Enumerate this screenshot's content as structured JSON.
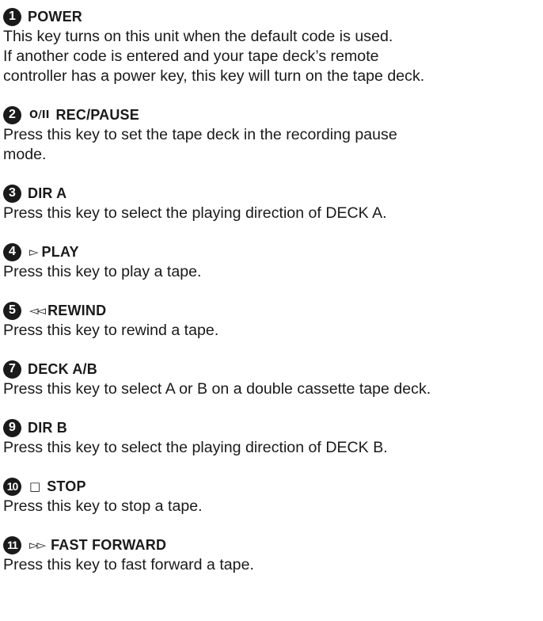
{
  "entries": [
    {
      "number": "1",
      "symbol": "",
      "key": "POWER",
      "description": "This key turns on this unit when the default code is used.\nIf another code is entered and your tape deck’s remote\ncontroller has a power key, this key will turn on the tape deck."
    },
    {
      "number": "2",
      "symbol": "O/II",
      "key": "REC/PAUSE",
      "description": "Press this key to set the tape deck in the recording pause\nmode."
    },
    {
      "number": "3",
      "symbol": "",
      "key": "DIR A",
      "description": "Press this key to select the playing direction of DECK A."
    },
    {
      "number": "4",
      "symbol": "▻",
      "key": "PLAY",
      "description": "Press this key to play a tape."
    },
    {
      "number": "5",
      "symbol": "◅◅",
      "key": "REWIND",
      "description": "Press this key to rewind a tape."
    },
    {
      "number": "7",
      "symbol": "",
      "key": "DECK A/B",
      "description": "Press this key to select A or B on a double cassette tape deck."
    },
    {
      "number": "9",
      "symbol": "",
      "key": "DIR B",
      "description": "Press this key to select the playing direction of DECK B."
    },
    {
      "number": "10",
      "symbol": "□",
      "key": "STOP",
      "description": "Press this key to stop a tape."
    },
    {
      "number": "11",
      "symbol": "▻▻",
      "key": "FAST FORWARD",
      "description": "Press this key to fast forward a tape."
    }
  ]
}
